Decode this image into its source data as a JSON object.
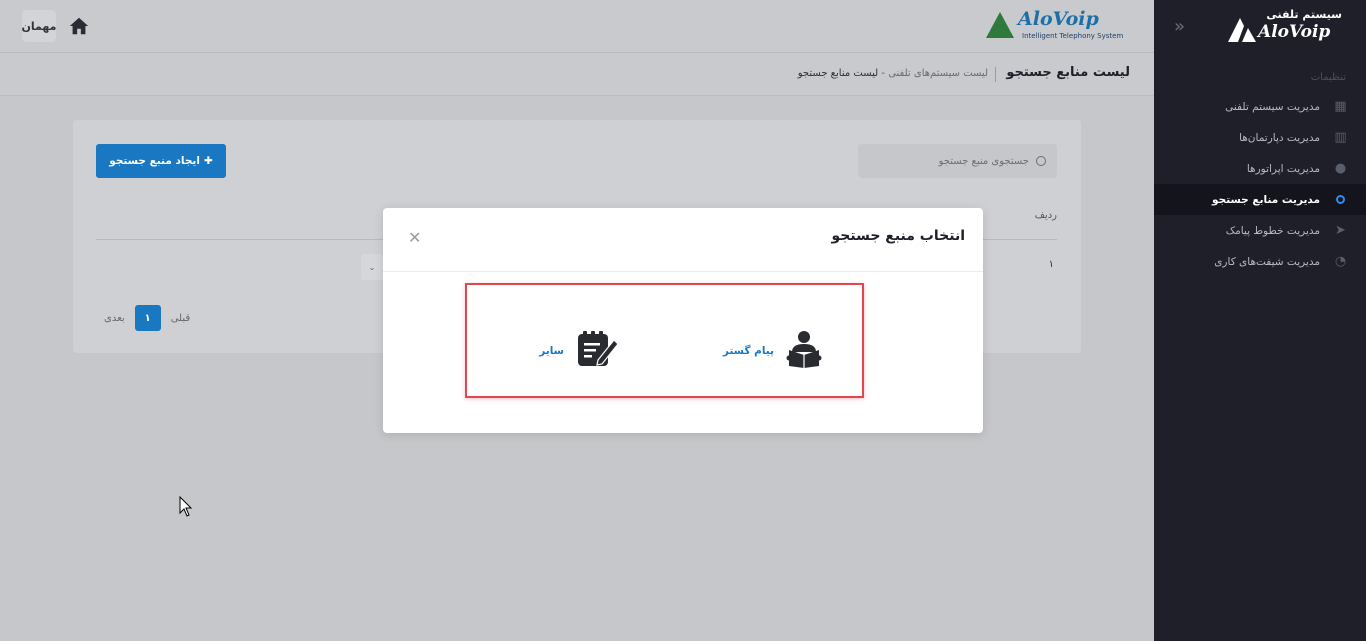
{
  "sidebar": {
    "logo_fa": "سیستم تلفنی",
    "logo_en": "AloVoip",
    "section_label": "تنظیمات",
    "items": [
      {
        "label": "مدیریت سیستم تلفنی",
        "icon": "building-icon",
        "active": false
      },
      {
        "label": "مدیریت دپارتمان‌ها",
        "icon": "office-icon",
        "active": false
      },
      {
        "label": "مدیریت اپراتورها",
        "icon": "operator-icon",
        "active": false
      },
      {
        "label": "مدیریت منابع جستجو",
        "icon": "circle-icon",
        "active": true
      },
      {
        "label": "مدیریت خطوط پیامک",
        "icon": "send-icon",
        "active": false
      },
      {
        "label": "مدیریت شیفت‌های کاری",
        "icon": "shift-icon",
        "active": false
      }
    ]
  },
  "header": {
    "logo_en": "AloVoip",
    "logo_sub": "Intelligent Telephony System",
    "guest_label": "مهمان"
  },
  "page": {
    "title": "لیست منابع جستجو",
    "breadcrumb": {
      "parent": "لیست سیستم‌های تلفنی",
      "separator": "-",
      "current": "لیست منابع جستجو"
    }
  },
  "card": {
    "create_button": "ایجاد منبع جستجو",
    "search_placeholder": "جستجوی منبع جستجو",
    "table": {
      "headers": [
        "ردیف"
      ],
      "rows": [
        [
          "۱"
        ]
      ]
    },
    "pager": {
      "prev": "قبلی",
      "current": "۱",
      "next": "بعدی"
    }
  },
  "modal": {
    "title": "انتخاب منبع جستجو",
    "options": [
      {
        "label": "پیام گستر",
        "icon": "reader-icon"
      },
      {
        "label": "سایر",
        "icon": "note-edit-icon"
      }
    ]
  },
  "colors": {
    "primary": "#1a78c2",
    "sidebar_bg": "#1e1f28",
    "highlight_border": "#e0484e"
  }
}
